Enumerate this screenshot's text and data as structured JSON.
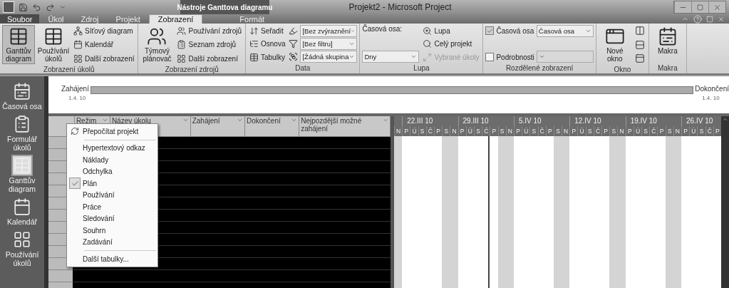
{
  "title_bar": {
    "context_tab": "Nástroje Ganttova diagramu",
    "title": "Projekt2 - Microsoft Project"
  },
  "tabs": [
    {
      "label": "Soubor",
      "selected": false,
      "kind": "file"
    },
    {
      "label": "Úkol",
      "selected": false,
      "kind": "normal"
    },
    {
      "label": "Zdroj",
      "selected": false,
      "kind": "normal"
    },
    {
      "label": "Projekt",
      "selected": false,
      "kind": "normal"
    },
    {
      "label": "Zobrazení",
      "selected": true,
      "kind": "normal"
    },
    {
      "label": "Formát",
      "selected": false,
      "kind": "context"
    }
  ],
  "ribbon": [
    {
      "label": "Zobrazení úkolů",
      "columns": [
        [
          {
            "kind": "big",
            "label": "Ganttův diagram",
            "selected": true
          }
        ],
        [
          {
            "kind": "big",
            "label": "Používání úkolů",
            "selected": false
          }
        ],
        [
          {
            "kind": "small",
            "label": "Síťový diagram",
            "disabled": false
          },
          {
            "kind": "small",
            "label": "Kalendář",
            "disabled": false
          },
          {
            "kind": "small",
            "label": "Další zobrazení",
            "disabled": false
          }
        ]
      ]
    },
    {
      "label": "Zobrazení zdrojů",
      "columns": [
        [
          {
            "kind": "big",
            "label": "Týmový plánovač",
            "selected": false
          }
        ],
        [
          {
            "kind": "small",
            "label": "Používání zdrojů",
            "disabled": false
          },
          {
            "kind": "small",
            "label": "Seznam zdrojů",
            "disabled": false
          },
          {
            "kind": "small",
            "label": "Další zobrazení",
            "disabled": false
          }
        ]
      ]
    },
    {
      "label": "Data",
      "columns": [
        [
          {
            "kind": "small",
            "label": "Seřadit",
            "disabled": false
          },
          {
            "kind": "small",
            "label": "Osnova",
            "disabled": false
          },
          {
            "kind": "small",
            "label": "Tabulky",
            "disabled": false
          }
        ],
        [
          {
            "kind": "select",
            "value": "[Bez zvýraznění",
            "disabled": false
          },
          {
            "kind": "select",
            "value": "[Bez filtru]",
            "disabled": false
          },
          {
            "kind": "select",
            "value": "[Žádná skupina",
            "disabled": false
          }
        ]
      ]
    },
    {
      "label": "Lupa",
      "columns": [
        [
          {
            "kind": "text",
            "label": "Časová osa:"
          },
          {
            "kind": "select",
            "value": "Dny",
            "disabled": false
          }
        ],
        [
          {
            "kind": "small",
            "label": "Lupa",
            "disabled": false
          },
          {
            "kind": "small",
            "label": "Celý projekt",
            "disabled": false
          },
          {
            "kind": "small",
            "label": "Vybrané úkoly",
            "disabled": true
          }
        ]
      ]
    },
    {
      "label": "Rozdělené zobrazení",
      "columns": [
        [
          {
            "kind": "check",
            "label": "Časová osa",
            "checked": true
          },
          {
            "kind": "check",
            "label": "Podrobnosti",
            "checked": false
          }
        ],
        [
          {
            "kind": "select",
            "value": "Časová osa",
            "disabled": false
          },
          {
            "kind": "select",
            "disabled": true
          }
        ]
      ]
    },
    {
      "label": "Okno",
      "columns": [
        [
          {
            "kind": "big",
            "label": "Nové okno",
            "selected": false
          }
        ],
        [
          {
            "kind": "icon",
            "disabled": false
          },
          {
            "kind": "icon",
            "disabled": false
          },
          {
            "kind": "icon",
            "disabled": false
          }
        ]
      ]
    },
    {
      "label": "Makra",
      "columns": [
        [
          {
            "kind": "big",
            "label": "Makra",
            "selected": false
          }
        ]
      ]
    }
  ],
  "view_bar": [
    {
      "label": "Časová osa",
      "selected": false
    },
    {
      "label": "Formulář úkolů",
      "selected": false
    },
    {
      "label": "Ganttův diagram",
      "selected": true
    },
    {
      "label": "Kalendář",
      "selected": false
    },
    {
      "label": "Používání úkolů",
      "selected": false
    }
  ],
  "timeline": {
    "start_label": "Zahájení",
    "start_date": "1.4. 10",
    "end_label": "Dokončení",
    "end_date": "1.4. 10"
  },
  "table": {
    "columns": [
      {
        "label": "Režim"
      },
      {
        "label": "Název úkolu"
      },
      {
        "label": "Zahájení"
      },
      {
        "label": "Dokončení"
      },
      {
        "label": "Nejpozdější možné zahájení"
      }
    ]
  },
  "gantt": {
    "weeks": [
      "22.III 10",
      "29.III 10",
      "5.IV 10",
      "12.IV 10",
      "19.IV 10",
      "26.IV 10"
    ],
    "days": [
      {
        "label": "N",
        "weekend": true,
        "line": false
      },
      {
        "label": "P",
        "weekend": false,
        "line": false
      },
      {
        "label": "Ú",
        "weekend": false,
        "line": false
      },
      {
        "label": "S",
        "weekend": false,
        "line": false
      },
      {
        "label": "Č",
        "weekend": false,
        "line": false
      },
      {
        "label": "P",
        "weekend": false,
        "line": false
      },
      {
        "label": "S",
        "weekend": true,
        "line": false
      },
      {
        "label": "N",
        "weekend": true,
        "line": false
      },
      {
        "label": "P",
        "weekend": false,
        "line": false
      },
      {
        "label": "Ú",
        "weekend": false,
        "line": false
      },
      {
        "label": "S",
        "weekend": false,
        "line": false
      },
      {
        "label": "Č",
        "weekend": false,
        "line": true
      },
      {
        "label": "P",
        "weekend": false,
        "line": false
      },
      {
        "label": "S",
        "weekend": true,
        "line": false
      },
      {
        "label": "N",
        "weekend": true,
        "line": false
      },
      {
        "label": "P",
        "weekend": false,
        "line": false
      },
      {
        "label": "Ú",
        "weekend": false,
        "line": false
      },
      {
        "label": "S",
        "weekend": false,
        "line": false
      },
      {
        "label": "Č",
        "weekend": false,
        "line": false
      },
      {
        "label": "P",
        "weekend": false,
        "line": false
      },
      {
        "label": "S",
        "weekend": true,
        "line": false
      },
      {
        "label": "N",
        "weekend": true,
        "line": false
      },
      {
        "label": "P",
        "weekend": false,
        "line": false
      },
      {
        "label": "Ú",
        "weekend": false,
        "line": false
      },
      {
        "label": "S",
        "weekend": false,
        "line": false
      },
      {
        "label": "Č",
        "weekend": false,
        "line": false
      },
      {
        "label": "P",
        "weekend": false,
        "line": false
      },
      {
        "label": "S",
        "weekend": true,
        "line": false
      },
      {
        "label": "N",
        "weekend": true,
        "line": false
      },
      {
        "label": "P",
        "weekend": false,
        "line": false
      },
      {
        "label": "Ú",
        "weekend": false,
        "line": false
      },
      {
        "label": "S",
        "weekend": false,
        "line": false
      },
      {
        "label": "Č",
        "weekend": false,
        "line": false
      },
      {
        "label": "P",
        "weekend": false,
        "line": false
      },
      {
        "label": "S",
        "weekend": true,
        "line": false
      },
      {
        "label": "N",
        "weekend": true,
        "line": false
      },
      {
        "label": "P",
        "weekend": false,
        "line": false
      },
      {
        "label": "Ú",
        "weekend": false,
        "line": false
      },
      {
        "label": "S",
        "weekend": false,
        "line": false
      },
      {
        "label": "Č",
        "weekend": false,
        "line": false
      },
      {
        "label": "P",
        "weekend": false,
        "line": false
      }
    ]
  },
  "menu": [
    {
      "kind": "command",
      "label": "Přepočítat projekt"
    },
    {
      "kind": "separator"
    },
    {
      "kind": "table",
      "label": "Hypertextový odkaz",
      "checked": false
    },
    {
      "kind": "table",
      "label": "Náklady",
      "checked": false
    },
    {
      "kind": "table",
      "label": "Odchylka",
      "checked": false
    },
    {
      "kind": "table",
      "label": "Plán",
      "checked": true
    },
    {
      "kind": "table",
      "label": "Používání",
      "checked": false
    },
    {
      "kind": "table",
      "label": "Práce",
      "checked": false
    },
    {
      "kind": "table",
      "label": "Sledování",
      "checked": false
    },
    {
      "kind": "table",
      "label": "Souhrn",
      "checked": false
    },
    {
      "kind": "table",
      "label": "Zadávání",
      "checked": false
    },
    {
      "kind": "separator"
    },
    {
      "kind": "table",
      "label": "Další tabulky...",
      "checked": false
    }
  ]
}
